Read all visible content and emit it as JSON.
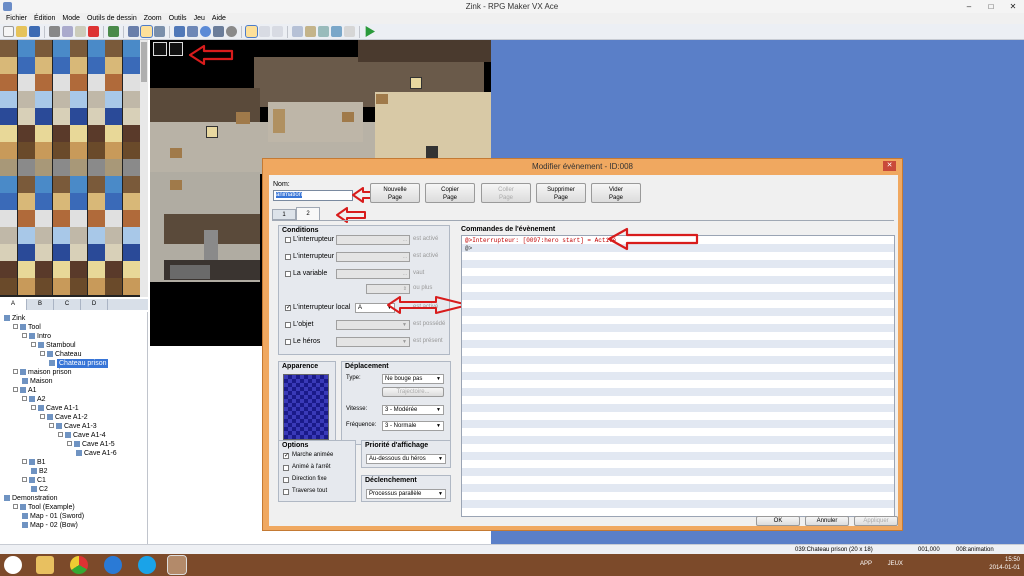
{
  "window": {
    "title": "Zink - RPG Maker VX Ace",
    "minimize": "–",
    "maximize": "□",
    "close": "✕"
  },
  "menu": [
    "Fichier",
    "Édition",
    "Mode",
    "Outils de dessin",
    "Zoom",
    "Outils",
    "Jeu",
    "Aide"
  ],
  "tile_tabs": [
    "A",
    "B",
    "C",
    "D"
  ],
  "map_tree": [
    {
      "label": "Zink",
      "depth": 0
    },
    {
      "label": "Tool",
      "depth": 1
    },
    {
      "label": "Intro",
      "depth": 2
    },
    {
      "label": "Stamboul",
      "depth": 3
    },
    {
      "label": "Chateau",
      "depth": 4
    },
    {
      "label": "Chateau prison",
      "depth": 5,
      "selected": true
    },
    {
      "label": "maison prison",
      "depth": 1
    },
    {
      "label": "Maison",
      "depth": 2
    },
    {
      "label": "A1",
      "depth": 1
    },
    {
      "label": "A2",
      "depth": 2
    },
    {
      "label": "Cave A1-1",
      "depth": 3
    },
    {
      "label": "Cave A1-2",
      "depth": 4
    },
    {
      "label": "Cave A1-3",
      "depth": 5
    },
    {
      "label": "Cave A1-4",
      "depth": 6
    },
    {
      "label": "Cave A1-5",
      "depth": 7
    },
    {
      "label": "Cave A1-6",
      "depth": 8
    },
    {
      "label": "B1",
      "depth": 2
    },
    {
      "label": "B2",
      "depth": 3
    },
    {
      "label": "C1",
      "depth": 2
    },
    {
      "label": "C2",
      "depth": 3
    },
    {
      "label": "Demonstration",
      "depth": 0
    },
    {
      "label": "Tool (Example)",
      "depth": 1
    },
    {
      "label": "Map - 01 (Sword)",
      "depth": 2
    },
    {
      "label": "Map - 02 (Bow)",
      "depth": 2
    }
  ],
  "dialog": {
    "title": "Modifier évènement - ID:008",
    "close": "✕",
    "name_label": "Nom:",
    "name_value": "animation",
    "buttons": {
      "new_page": [
        "Nouvelle",
        "Page"
      ],
      "copy_page": [
        "Copier",
        "Page"
      ],
      "paste_page": [
        "Coller",
        "Page"
      ],
      "delete_page": [
        "Supprimer",
        "Page"
      ],
      "clear_page": [
        "Vider",
        "Page"
      ]
    },
    "page_tabs": [
      "1",
      "2"
    ],
    "conditions": {
      "title": "Conditions",
      "switch1": {
        "label": "L'interrupteur",
        "value": "",
        "suffix": "est activé",
        "checked": false
      },
      "switch2": {
        "label": "L'interrupteur",
        "value": "",
        "suffix": "est activé",
        "checked": false
      },
      "variable": {
        "label": "La variable",
        "value": "",
        "suffix": "vaut",
        "extra": "ou plus",
        "checked": false
      },
      "self_switch": {
        "label": "L'interrupteur local",
        "value": "A",
        "suffix": "est activé",
        "checked": true
      },
      "item": {
        "label": "L'objet",
        "value": "",
        "suffix": "est possédé",
        "checked": false
      },
      "actor": {
        "label": "Le héros",
        "value": "",
        "suffix": "est présent",
        "checked": false
      }
    },
    "appearance": {
      "title": "Apparence"
    },
    "movement": {
      "title": "Déplacement",
      "type_label": "Type:",
      "type_value": "Ne bouge pas",
      "route_button": "Trajectoire...",
      "speed_label": "Vitesse:",
      "speed_value": "3 - Modérée",
      "freq_label": "Fréquence:",
      "freq_value": "3 - Normale"
    },
    "options": {
      "title": "Options",
      "walking": {
        "label": "Marche animée",
        "checked": true
      },
      "stepping": {
        "label": "Animé à l'arrêt",
        "checked": false
      },
      "dir_fix": {
        "label": "Direction fixe",
        "checked": false
      },
      "through": {
        "label": "Traverse tout",
        "checked": false
      }
    },
    "priority": {
      "title": "Priorité d'affichage",
      "value": "Au-dessous du héros"
    },
    "trigger": {
      "title": "Déclenchement",
      "value": "Processus parallèle"
    },
    "commands": {
      "title": "Commandes de l'évènement",
      "lines": [
        "@>Interrupteur: [0097:hero start] = Activé",
        "@>"
      ]
    },
    "ok": "OK",
    "cancel": "Annuler",
    "apply": "Appliquer"
  },
  "status": {
    "map": "039:Chateau prison (20 x 18)",
    "coords": "001,000",
    "event": "008:animation"
  },
  "taskbar": {
    "tray_left": "APP",
    "tray_mid": "JEUX",
    "time": "15:50",
    "date": "2014-01-01"
  },
  "colors": {
    "dialog_frame": "#f0a860",
    "desktop_accent": "#5a7fc8",
    "annotation": "#d81c1c",
    "command_text": "#c00000",
    "taskbar": "#7c4a2a"
  }
}
